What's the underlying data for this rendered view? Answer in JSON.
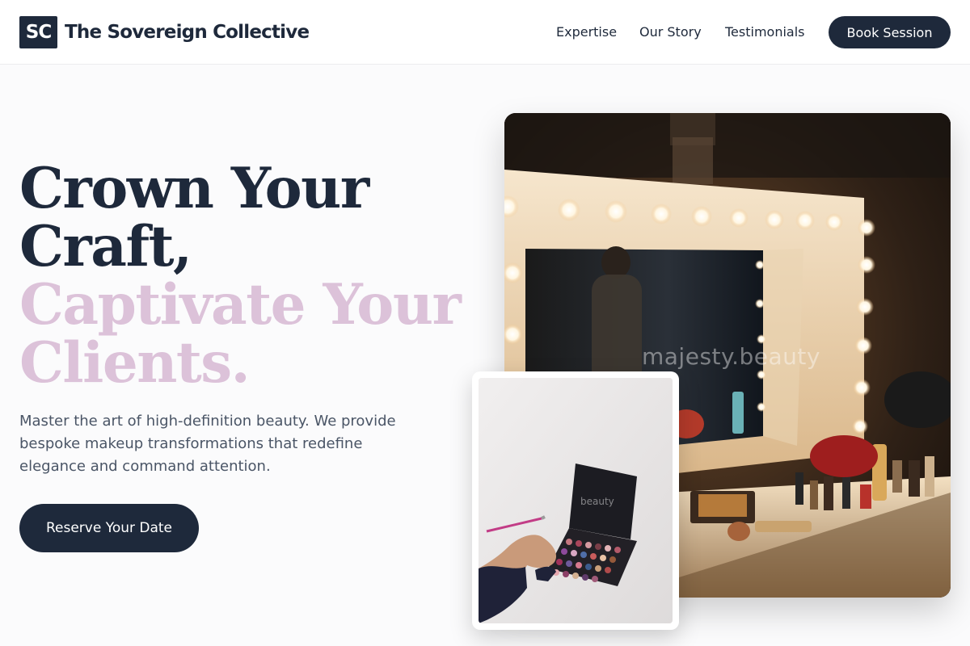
{
  "nav": {
    "logo_mark": "SC",
    "brand": "The Sovereign Collective",
    "links": [
      "Expertise",
      "Our Story",
      "Testimonials"
    ],
    "cta": "Book Session"
  },
  "hero": {
    "headline_line1": "Crown Your",
    "headline_line2": "Craft,",
    "headline_accent1": "Captivate Your",
    "headline_accent2": "Clients.",
    "subcopy": "Master the art of high-definition beauty. We provide bespoke makeup transformations that redefine elegance and command attention.",
    "cta": "Reserve Your Date"
  },
  "images": {
    "main_watermark": "majesty.beauty",
    "inset_watermark": "beauty"
  },
  "colors": {
    "navy": "#1e293b",
    "accent_pink": "#dcc2d9",
    "body_text": "#4a5566"
  }
}
